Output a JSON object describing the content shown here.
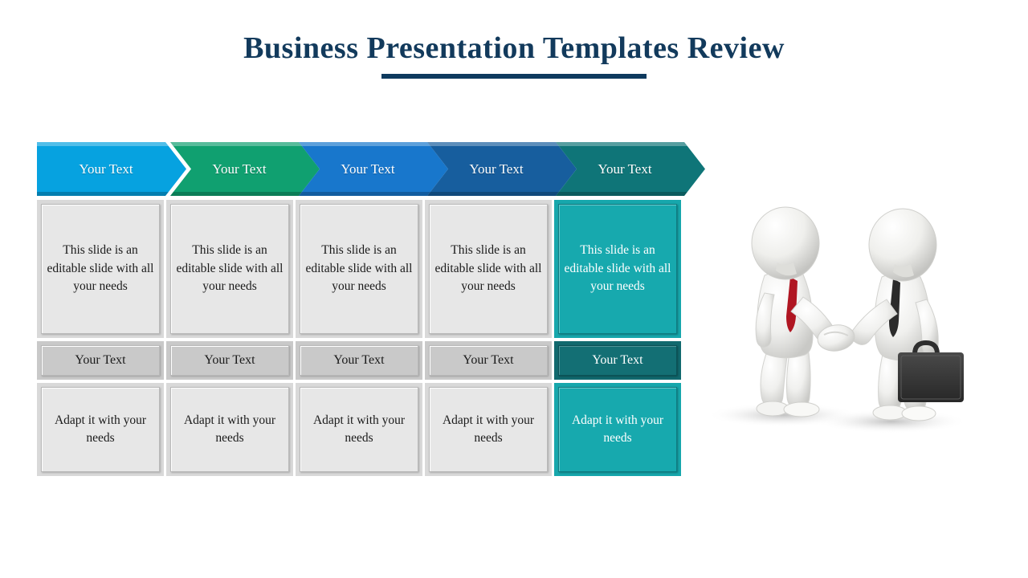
{
  "slide": {
    "title": "Business Presentation Templates Review",
    "background_color": "#ffffff",
    "title_color": "#123a5c",
    "title_underline_color": "#0e3a5e"
  },
  "process_arrows": {
    "count": 5,
    "items": [
      {
        "label": "Your Text",
        "color": "#06a2e0",
        "shape": "rectangle-with-point"
      },
      {
        "label": "Your Text",
        "color": "#10a070",
        "shape": "chevron"
      },
      {
        "label": "Your Text",
        "color": "#1877cc",
        "shape": "chevron"
      },
      {
        "label": "Your Text",
        "color": "#175e9e",
        "shape": "chevron"
      },
      {
        "label": "Your Text",
        "color": "#0f7578",
        "shape": "chevron"
      }
    ]
  },
  "grid": {
    "rows": [
      {
        "name": "description-row",
        "cells": [
          "This slide is an editable slide with all your needs",
          "This slide is an editable slide with all your needs",
          "This slide is an editable slide with all your needs",
          "This slide is an editable slide with all your needs",
          "This slide is an editable slide with all your needs"
        ]
      },
      {
        "name": "label-row",
        "cells": [
          "Your Text",
          "Your Text",
          "Your Text",
          "Your Text",
          "Your Text"
        ]
      },
      {
        "name": "adapt-row",
        "cells": [
          "Adapt it with your needs",
          "Adapt it with your needs",
          "Adapt it with your needs",
          "Adapt it with your needs",
          "Adapt it with your needs"
        ]
      }
    ],
    "highlighted_column_index": 4,
    "default_cell_color": "#e7e7e7",
    "label_cell_color": "#c9c9c9",
    "highlight_cell_color": "#17a9ae",
    "highlight_label_color": "#136f74"
  },
  "illustration": {
    "name": "handshake-figures",
    "description": "Two white 3D figures shaking hands",
    "left_figure_tie_color": "#b01622",
    "right_figure_tie_color": "#2b2b2b",
    "briefcase_color": "#343434"
  }
}
